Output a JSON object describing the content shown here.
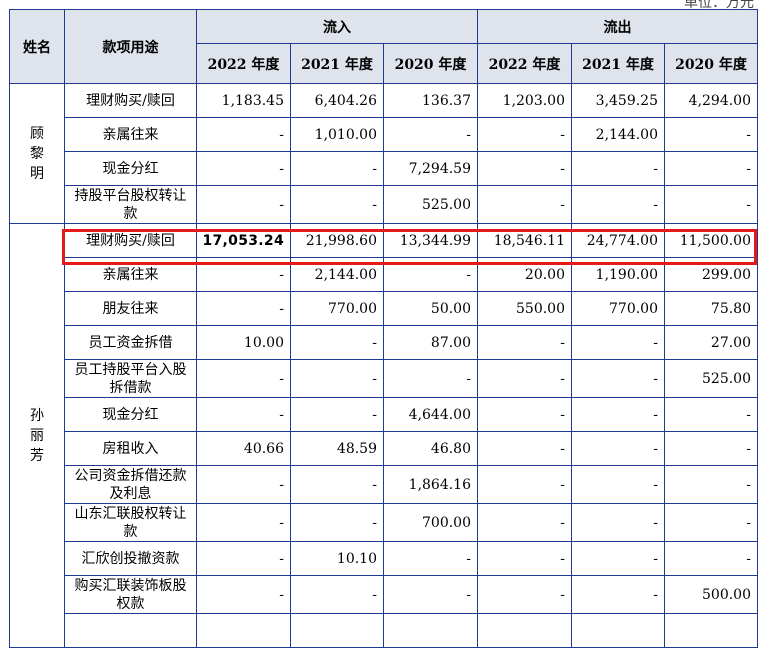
{
  "unit_text": "单位：万元",
  "header": {
    "name": "姓名",
    "use": "款项用途",
    "inflow": "流入",
    "outflow": "流出",
    "years": [
      "2022 年度",
      "2021 年度",
      "2020 年度"
    ]
  },
  "groups": [
    {
      "name": "顾黎明",
      "rows": [
        {
          "use": "理财购买/赎回",
          "values": [
            "1,183.45",
            "6,404.26",
            "136.37",
            "1,203.00",
            "3,459.25",
            "4,294.00"
          ]
        },
        {
          "use": "亲属往来",
          "values": [
            "-",
            "1,010.00",
            "-",
            "-",
            "2,144.00",
            "-"
          ]
        },
        {
          "use": "现金分红",
          "values": [
            "-",
            "-",
            "7,294.59",
            "-",
            "-",
            "-"
          ]
        },
        {
          "use": "持股平台股权转让款",
          "values": [
            "-",
            "-",
            "525.00",
            "-",
            "-",
            "-"
          ]
        }
      ]
    },
    {
      "name": "孙丽芳",
      "rows": [
        {
          "use": "理财购买/赎回",
          "values": [
            "17,053.24",
            "21,998.60",
            "13,344.99",
            "18,546.11",
            "24,774.00",
            "11,500.00"
          ],
          "highlight": true
        },
        {
          "use": "亲属往来",
          "values": [
            "-",
            "2,144.00",
            "-",
            "20.00",
            "1,190.00",
            "299.00"
          ]
        },
        {
          "use": "朋友往来",
          "values": [
            "-",
            "770.00",
            "50.00",
            "550.00",
            "770.00",
            "75.80"
          ]
        },
        {
          "use": "员工资金拆借",
          "values": [
            "10.00",
            "-",
            "87.00",
            "-",
            "-",
            "27.00"
          ]
        },
        {
          "use": "员工持股平台入股拆借款",
          "values": [
            "-",
            "-",
            "-",
            "-",
            "-",
            "525.00"
          ]
        },
        {
          "use": "现金分红",
          "values": [
            "-",
            "-",
            "4,644.00",
            "-",
            "-",
            "-"
          ]
        },
        {
          "use": "房租收入",
          "values": [
            "40.66",
            "48.59",
            "46.80",
            "-",
            "-",
            "-"
          ]
        },
        {
          "use": "公司资金拆借还款及利息",
          "values": [
            "-",
            "-",
            "1,864.16",
            "-",
            "-",
            "-"
          ]
        },
        {
          "use": "山东汇联股权转让款",
          "values": [
            "-",
            "-",
            "700.00",
            "-",
            "-",
            "-"
          ]
        },
        {
          "use": "汇欣创投撤资款",
          "values": [
            "-",
            "10.10",
            "-",
            "-",
            "-",
            "-"
          ]
        },
        {
          "use": "购买汇联装饰板股权款",
          "values": [
            "-",
            "-",
            "-",
            "-",
            "-",
            "500.00"
          ]
        },
        {
          "use": "",
          "values": [
            "",
            "",
            "",
            "",
            "",
            ""
          ]
        }
      ]
    }
  ],
  "colors": {
    "border": "#1f3a8f",
    "header_bg": "#dfe3eb",
    "highlight": "#e61919"
  }
}
